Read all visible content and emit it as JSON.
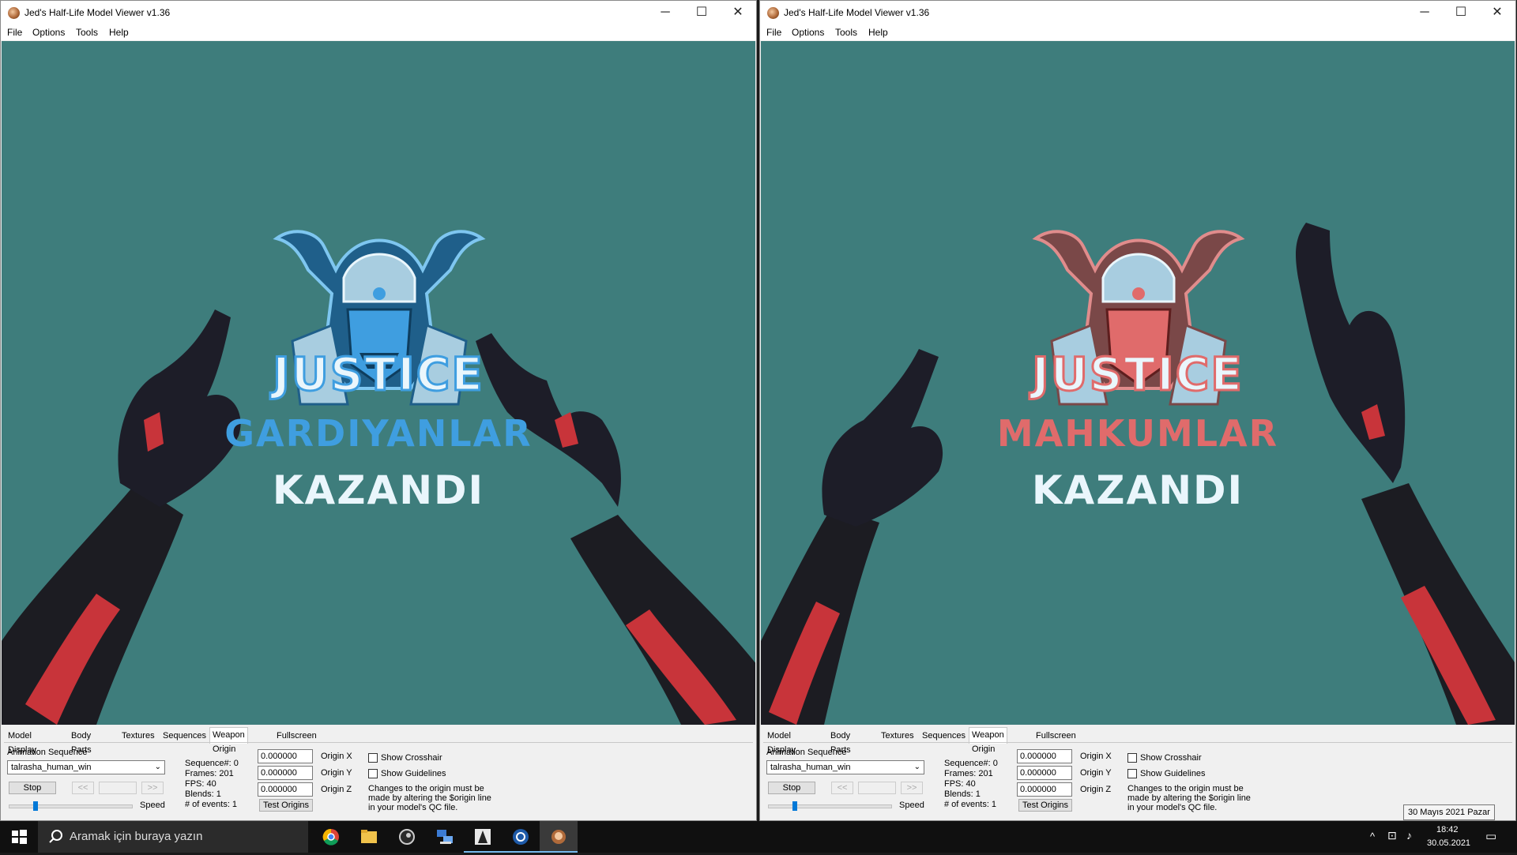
{
  "window_left": {
    "title": "Jed's Half-Life Model Viewer v1.36",
    "controls": {
      "minimize": "─",
      "maximize": "☐",
      "close": "✕"
    },
    "menu": [
      "File",
      "Options",
      "Tools",
      "Help"
    ],
    "viewport": {
      "background": "#3e7d7c",
      "logo_line1": "JUSTICE",
      "logo_line2": "GARDIYANLAR",
      "logo_line3": "KAZANDI",
      "accent": "#3f9ee0"
    },
    "tabs": [
      "Model Display",
      "Body Parts",
      "Textures",
      "Sequences",
      "Weapon Origin",
      "Fullscreen"
    ],
    "active_tab": "Weapon Origin",
    "panel": {
      "animation_label": "Animation Sequence",
      "sequence_value": "talrasha_human_win",
      "stop": "Stop",
      "prev": "<<",
      "next": ">>",
      "speed": "Speed",
      "info": [
        "Sequence#: 0",
        "Frames: 201",
        "FPS: 40",
        "Blends: 1",
        "# of events: 1"
      ],
      "origin_x": "0.000000",
      "origin_y": "0.000000",
      "origin_z": "0.000000",
      "origin_x_label": "Origin X",
      "origin_y_label": "Origin Y",
      "origin_z_label": "Origin Z",
      "test_origins": "Test Origins",
      "show_crosshair": "Show Crosshair",
      "show_guidelines": "Show Guidelines",
      "note": [
        "Changes to the origin must be",
        "made by altering the $origin line",
        "in your model's QC file."
      ]
    }
  },
  "window_right": {
    "title": "Jed's Half-Life Model Viewer v1.36",
    "controls": {
      "minimize": "─",
      "maximize": "☐",
      "close": "✕"
    },
    "menu": [
      "File",
      "Options",
      "Tools",
      "Help"
    ],
    "viewport": {
      "background": "#3e7d7c",
      "logo_line1": "JUSTICE",
      "logo_line2": "MAHKUMLAR",
      "logo_line3": "KAZANDI",
      "accent": "#e06b6b"
    },
    "tabs": [
      "Model Display",
      "Body Parts",
      "Textures",
      "Sequences",
      "Weapon Origin",
      "Fullscreen"
    ],
    "active_tab": "Weapon Origin",
    "panel": {
      "animation_label": "Animation Sequence",
      "sequence_value": "talrasha_human_win",
      "stop": "Stop",
      "prev": "<<",
      "next": ">>",
      "speed": "Speed",
      "info": [
        "Sequence#: 0",
        "Frames: 201",
        "FPS: 40",
        "Blends: 1",
        "# of events: 1"
      ],
      "origin_x": "0.000000",
      "origin_y": "0.000000",
      "origin_z": "0.000000",
      "origin_x_label": "Origin X",
      "origin_y_label": "Origin Y",
      "origin_z_label": "Origin Z",
      "test_origins": "Test Origins",
      "show_crosshair": "Show Crosshair",
      "show_guidelines": "Show Guidelines",
      "note": [
        "Changes to the origin must be",
        "made by altering the $origin line",
        "in your model's QC file."
      ]
    }
  },
  "taskbar": {
    "search_placeholder": "Aramak için buraya yazın",
    "apps": [
      "chrome-icon",
      "file-explorer-icon",
      "steam-icon",
      "network-tool-icon",
      "counter-strike-icon",
      "teamspeak-icon",
      "model-viewer-icon"
    ],
    "time": "18:42",
    "date": "30.05.2021",
    "tooltip": "30 Mayıs 2021 Pazar"
  }
}
